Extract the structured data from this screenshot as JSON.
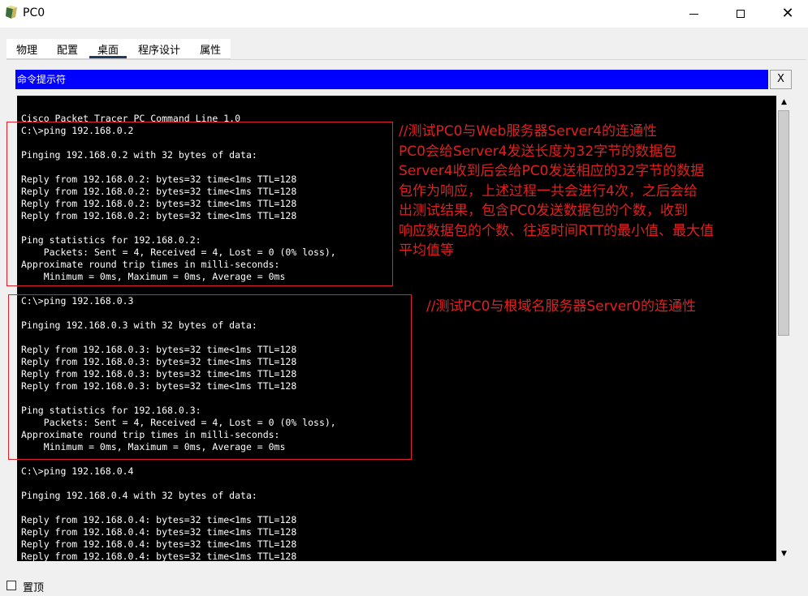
{
  "window": {
    "title": "PC0"
  },
  "tabs": [
    {
      "label": "物理"
    },
    {
      "label": "配置"
    },
    {
      "label": "桌面"
    },
    {
      "label": "程序设计"
    },
    {
      "label": "属性"
    }
  ],
  "active_tab": "桌面",
  "command_prompt": {
    "header_title": "命令提示符",
    "close_label": "X"
  },
  "terminal": {
    "lines": [
      "Cisco Packet Tracer PC Command Line 1.0",
      "C:\\>ping 192.168.0.2",
      "",
      "Pinging 192.168.0.2 with 32 bytes of data:",
      "",
      "Reply from 192.168.0.2: bytes=32 time<1ms TTL=128",
      "Reply from 192.168.0.2: bytes=32 time<1ms TTL=128",
      "Reply from 192.168.0.2: bytes=32 time<1ms TTL=128",
      "Reply from 192.168.0.2: bytes=32 time<1ms TTL=128",
      "",
      "Ping statistics for 192.168.0.2:",
      "    Packets: Sent = 4, Received = 4, Lost = 0 (0% loss),",
      "Approximate round trip times in milli-seconds:",
      "    Minimum = 0ms, Maximum = 0ms, Average = 0ms",
      "",
      "C:\\>ping 192.168.0.3",
      "",
      "Pinging 192.168.0.3 with 32 bytes of data:",
      "",
      "Reply from 192.168.0.3: bytes=32 time<1ms TTL=128",
      "Reply from 192.168.0.3: bytes=32 time<1ms TTL=128",
      "Reply from 192.168.0.3: bytes=32 time<1ms TTL=128",
      "Reply from 192.168.0.3: bytes=32 time<1ms TTL=128",
      "",
      "Ping statistics for 192.168.0.3:",
      "    Packets: Sent = 4, Received = 4, Lost = 0 (0% loss),",
      "Approximate round trip times in milli-seconds:",
      "    Minimum = 0ms, Maximum = 0ms, Average = 0ms",
      "",
      "C:\\>ping 192.168.0.4",
      "",
      "Pinging 192.168.0.4 with 32 bytes of data:",
      "",
      "Reply from 192.168.0.4: bytes=32 time<1ms TTL=128",
      "Reply from 192.168.0.4: bytes=32 time<1ms TTL=128",
      "Reply from 192.168.0.4: bytes=32 time<1ms TTL=128",
      "Reply from 192.168.0.4: bytes=32 time<1ms TTL=128"
    ]
  },
  "annotations": {
    "note_1": "//测试PC0与Web服务器Server4的连通性\nPC0会给Server4发送长度为32字节的数据包\nServer4收到后会给PC0发送相应的32字节的数据\n包作为响应，上述过程一共会进行4次，之后会给\n出测试结果，包含PC0发送数据包的个数，收到\n响应数据包的个数、往返时间RTT的最小值、最大值\n平均值等",
    "note_2": "//测试PC0与根域名服务器Server0的连通性",
    "color": "#e02020"
  },
  "bottom": {
    "always_on_top_label": "置顶",
    "always_on_top_checked": false
  },
  "colors": {
    "header_blue": "#0000ff",
    "terminal_bg": "#000000",
    "terminal_fg": "#ffffff"
  },
  "icons": {
    "app": "packet-tracer-pc-icon",
    "scroll_up": "triangle-up",
    "scroll_down": "triangle-down"
  }
}
